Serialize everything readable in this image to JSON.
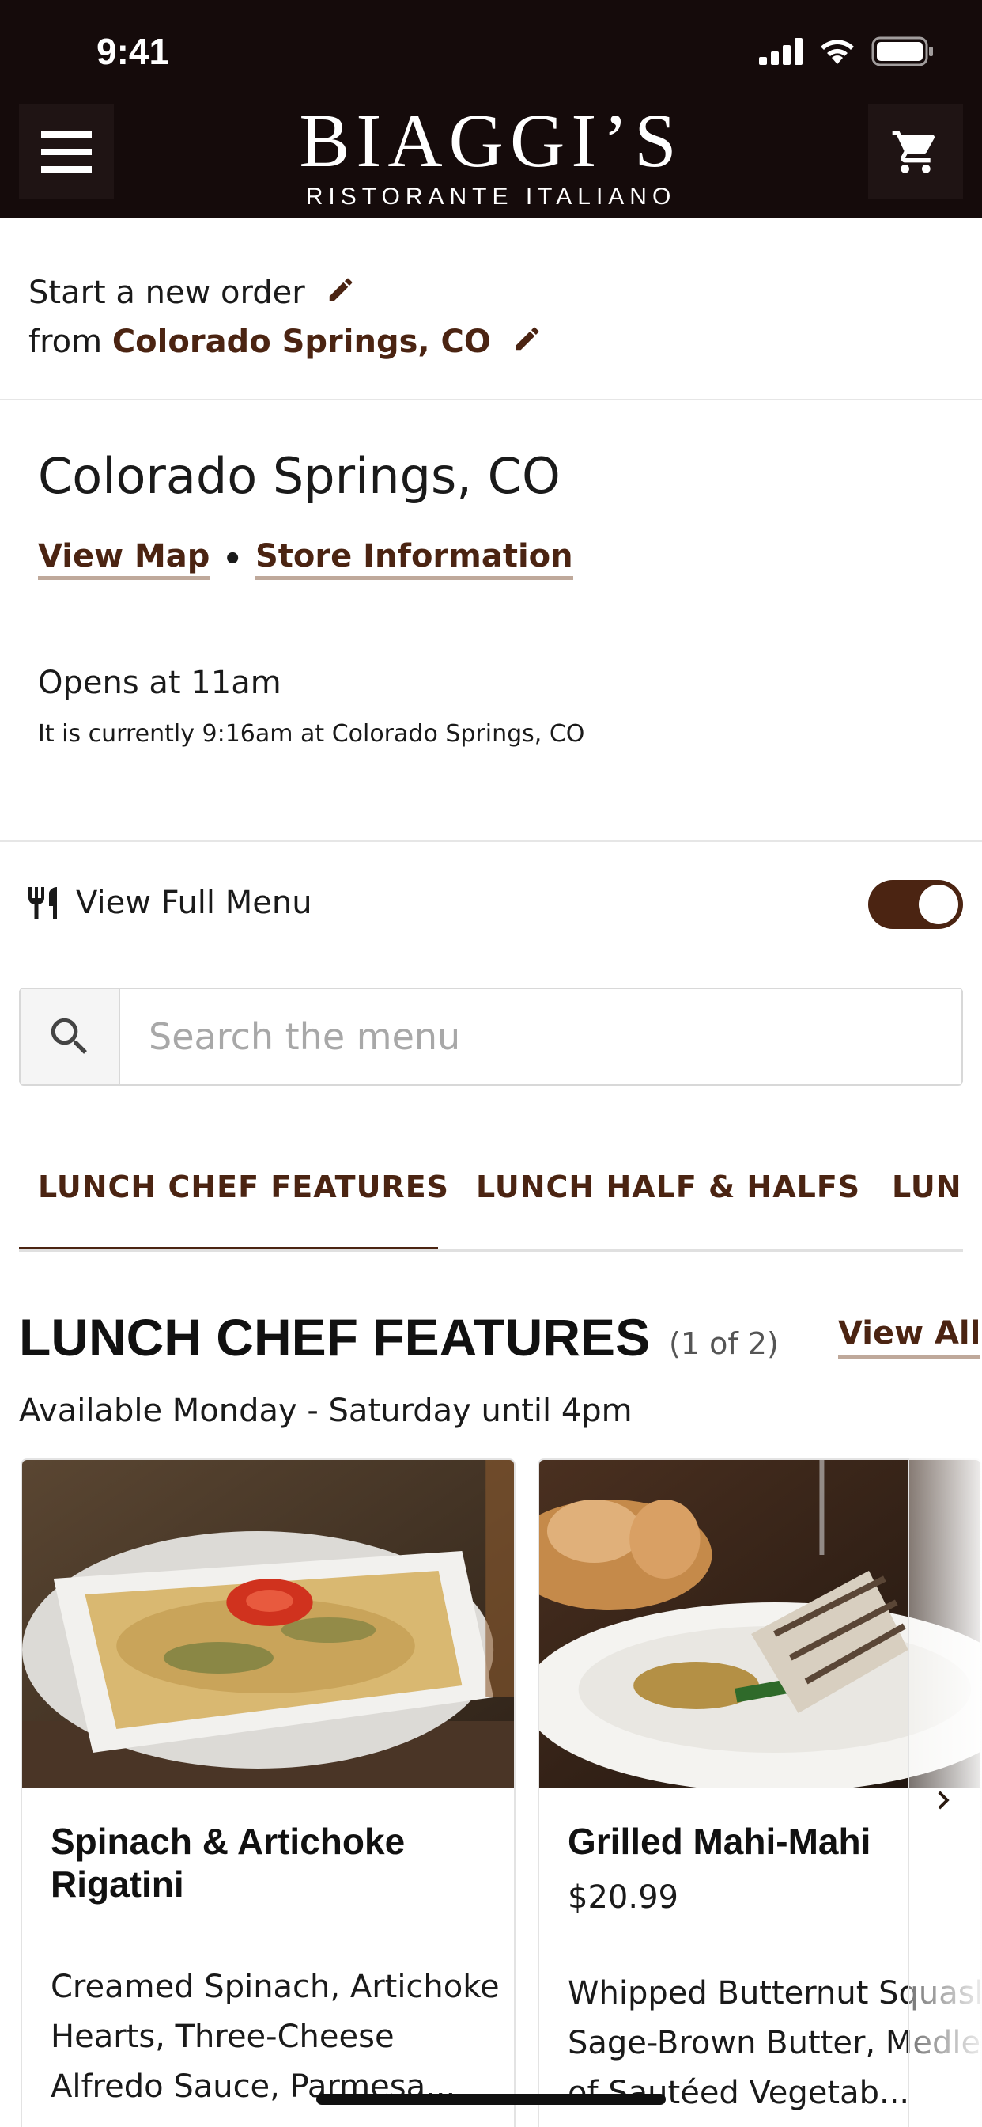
{
  "status_bar": {
    "time": "9:41"
  },
  "header": {
    "logo_main": "BIAGGI’S",
    "logo_sub": "RISTORANTE ITALIANO",
    "icons": {
      "menu": "hamburger-icon",
      "cart": "cart-icon"
    }
  },
  "order": {
    "line1": "Start a new order",
    "from_label": "from",
    "location": "Colorado Springs, CO"
  },
  "store": {
    "title": "Colorado Springs, CO",
    "view_map": "View Map",
    "separator": "•",
    "store_info": "Store Information",
    "opens": "Opens at 11am",
    "current_time_note": "It is currently 9:16am at Colorado Springs, CO"
  },
  "full_menu": {
    "label": "View Full Menu",
    "enabled": true
  },
  "search": {
    "placeholder": "Search the menu"
  },
  "tabs": [
    {
      "label": "LUNCH CHEF FEATURES",
      "active": true
    },
    {
      "label": "LUNCH HALF & HALFS",
      "active": false
    },
    {
      "label": "LUNCH",
      "active": false
    }
  ],
  "section": {
    "title": "LUNCH CHEF FEATURES",
    "count": "(1 of 2)",
    "view_all": "View All",
    "subtitle": "Available Monday - Saturday until 4pm"
  },
  "items": [
    {
      "name_line1": "Spinach & Artichoke",
      "name_line2": "Rigatini",
      "desc_line1": "Creamed Spinach, Artichoke",
      "desc_line2": "Hearts, Three-Cheese",
      "desc_line3": "Alfredo Sauce, Parmesa..."
    },
    {
      "name_line1": "Grilled Mahi-Mahi",
      "price": "$20.99",
      "desc_line1": "Whipped Butternut Squash,",
      "desc_line2": "Sage-Brown Butter, Medley",
      "desc_line3": "of Sautéed Vegetab..."
    }
  ],
  "colors": {
    "header_bg": "#150b0b",
    "brand_brown": "#4b2412",
    "link_underline": "#bfa99b"
  }
}
